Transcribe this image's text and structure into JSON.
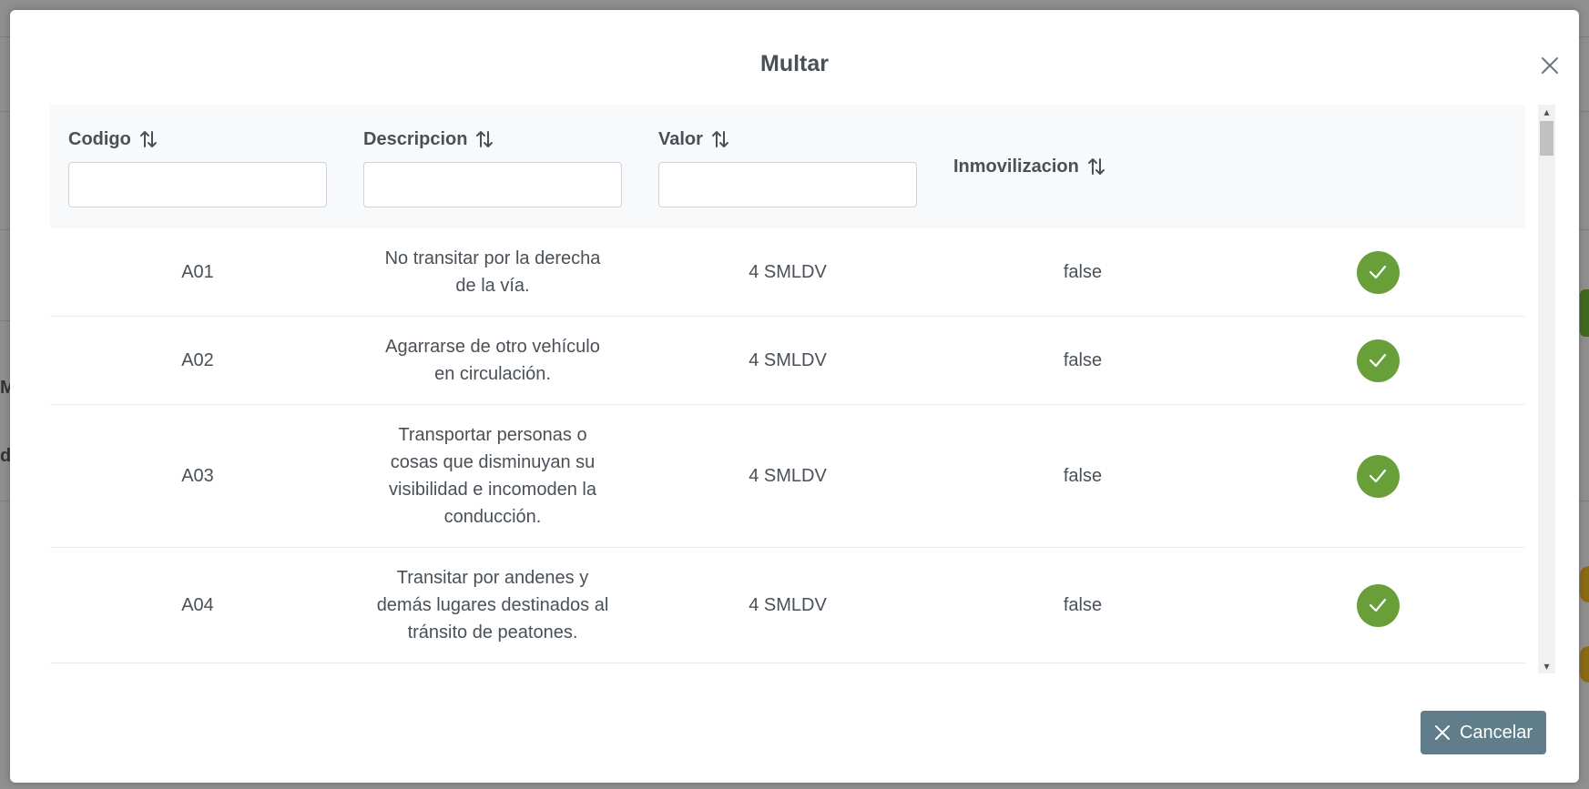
{
  "background": {
    "fragment_1": "M",
    "fragment_2": "d"
  },
  "modal": {
    "title": "Multar",
    "close_icon": "close-icon"
  },
  "table": {
    "columns": [
      {
        "label": "Codigo",
        "filter_value": "",
        "filter_placeholder": ""
      },
      {
        "label": "Descripcion",
        "filter_value": "",
        "filter_placeholder": ""
      },
      {
        "label": "Valor",
        "filter_value": "",
        "filter_placeholder": ""
      },
      {
        "label": "Inmovilizacion"
      }
    ],
    "sort_icon": "sort-alt-icon",
    "rows": [
      {
        "codigo": "A01",
        "descripcion": "No transitar por la derecha de la vía.",
        "valor": "4 SMLDV",
        "inmovilizacion": "false"
      },
      {
        "codigo": "A02",
        "descripcion": "Agarrarse de otro vehículo en circulación.",
        "valor": "4 SMLDV",
        "inmovilizacion": "false"
      },
      {
        "codigo": "A03",
        "descripcion": "Transportar personas o cosas que disminuyan su visibilidad e incomoden la conducción.",
        "valor": "4 SMLDV",
        "inmovilizacion": "false"
      },
      {
        "codigo": "A04",
        "descripcion": "Transitar por andenes y demás lugares destinados al tránsito de peatones.",
        "valor": "4 SMLDV",
        "inmovilizacion": "false"
      }
    ],
    "row_action_icon": "check-icon"
  },
  "footer": {
    "cancel_label": "Cancelar",
    "cancel_icon": "times-icon"
  },
  "colors": {
    "accent_green": "#689f38",
    "cancel_button": "#607d8b",
    "header_bg": "#f8f9fa",
    "text": "#495057"
  }
}
